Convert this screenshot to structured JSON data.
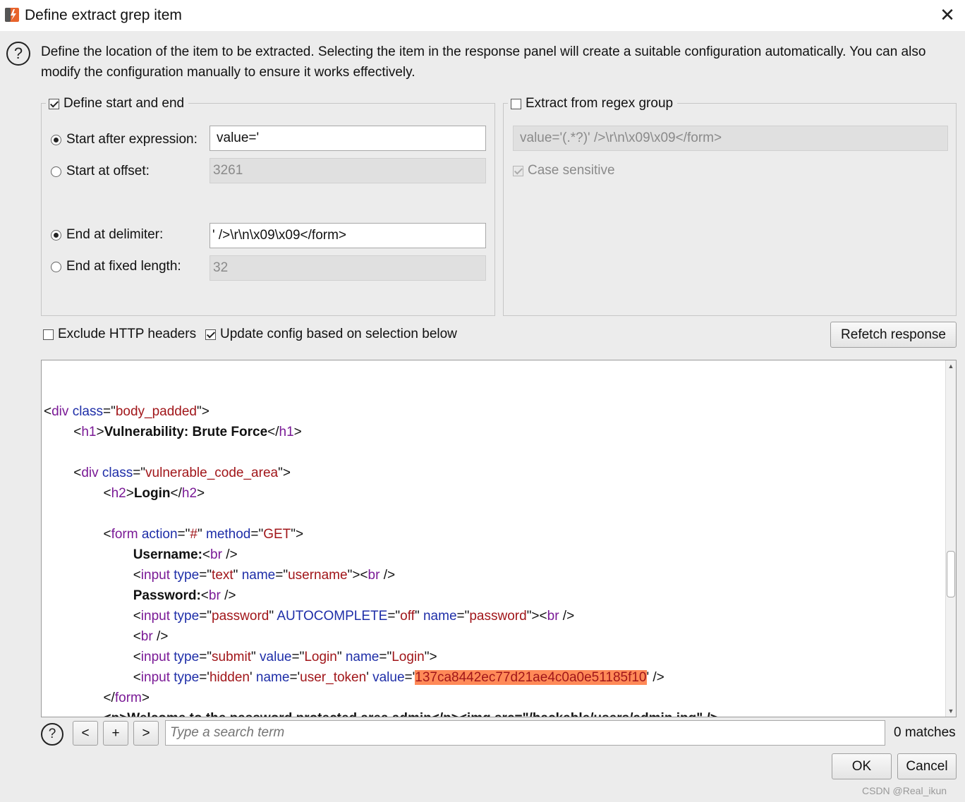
{
  "window": {
    "title": "Define extract grep item",
    "close_label": "✕"
  },
  "description": "Define the location of the item to be extracted. Selecting the item in the response panel will create a suitable configuration automatically. You can also modify the configuration manually to ensure it works effectively.",
  "start_end_group": {
    "label": "Define start and end",
    "checked": true,
    "start_after_label": "Start after expression:",
    "start_after_value": "value='",
    "start_offset_label": "Start at offset:",
    "start_offset_value": "3261",
    "end_delim_label": "End at delimiter:",
    "end_delim_value": "' />\\r\\n\\x09\\x09</form>",
    "end_fixed_label": "End at fixed length:",
    "end_fixed_value": "32"
  },
  "regex_group": {
    "label": "Extract from regex group",
    "checked": false,
    "regex_value": "value='(.*?)' />\\r\\n\\x09\\x09</form>",
    "case_sensitive_label": "Case sensitive"
  },
  "options": {
    "exclude_headers_label": "Exclude HTTP headers",
    "update_config_label": "Update config based on selection below",
    "refetch_label": "Refetch response"
  },
  "response_code": {
    "div_class": "body_padded",
    "h1_text": "Vulnerability: Brute Force",
    "div2_class": "vulnerable_code_area",
    "h2_text": "Login",
    "form_action": "#",
    "form_method": "GET",
    "username_label": "Username:",
    "input1_type": "text",
    "input1_name": "username",
    "password_label": "Password:",
    "input2_type": "password",
    "input2_autocomplete": "off",
    "input2_name": "password",
    "input3_type": "submit",
    "input3_value": "Login",
    "input3_name": "Login",
    "input4_type": "hidden",
    "input4_name": "user_token",
    "token_value": "137ca8442ec77d21ae4c0a0e51185f10",
    "partial_line": "<p>Welcome to the password protected area admin</p><img src=\"/hackable/users/admin.jpg\" />"
  },
  "search": {
    "prev_label": "<",
    "add_label": "+",
    "next_label": ">",
    "placeholder": "Type a search term",
    "matches_label": "0 matches"
  },
  "footer": {
    "ok_label": "OK",
    "cancel_label": "Cancel",
    "watermark": "CSDN @Real_ikun"
  }
}
